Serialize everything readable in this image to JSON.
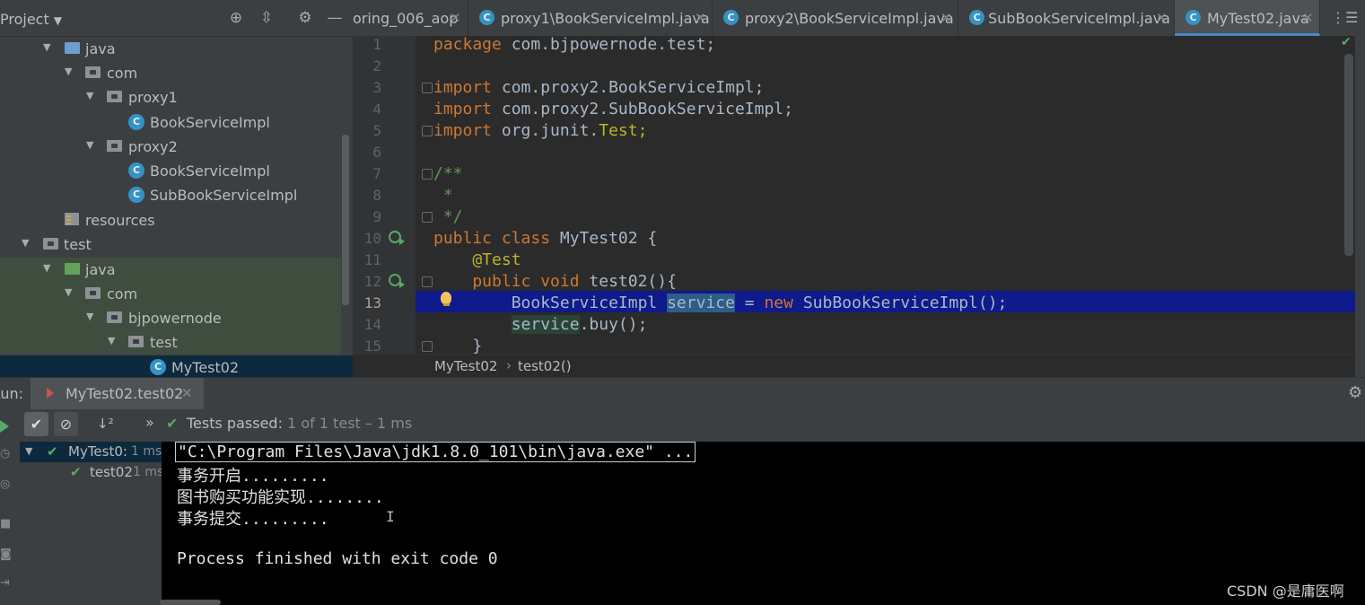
{
  "project": {
    "title": "Project",
    "tree": [
      {
        "label": "java",
        "kind": "folder-blue"
      },
      {
        "label": "com",
        "kind": "package"
      },
      {
        "label": "proxy1",
        "kind": "package"
      },
      {
        "label": "BookServiceImpl",
        "kind": "class"
      },
      {
        "label": "proxy2",
        "kind": "package"
      },
      {
        "label": "BookServiceImpl",
        "kind": "class"
      },
      {
        "label": "SubBookServiceImpl",
        "kind": "class"
      },
      {
        "label": "resources",
        "kind": "resources"
      },
      {
        "label": "test",
        "kind": "folder"
      },
      {
        "label": "java",
        "kind": "folder-green"
      },
      {
        "label": "com",
        "kind": "package"
      },
      {
        "label": "bjpowernode",
        "kind": "package"
      },
      {
        "label": "test",
        "kind": "package"
      },
      {
        "label": "MyTest02",
        "kind": "test-class"
      }
    ]
  },
  "tabs": [
    {
      "label": "oring_006_aop",
      "icon": "module-icon"
    },
    {
      "label": "proxy1\\BookServiceImpl.java",
      "icon": "class-icon"
    },
    {
      "label": "proxy2\\BookServiceImpl.java",
      "icon": "class-icon"
    },
    {
      "label": "SubBookServiceImpl.java",
      "icon": "class-icon"
    },
    {
      "label": "MyTest02.java",
      "icon": "class-icon",
      "active": true
    }
  ],
  "editor": {
    "line_numbers": [
      "1",
      "2",
      "3",
      "4",
      "5",
      "6",
      "7",
      "8",
      "9",
      "10",
      "11",
      "12",
      "13",
      "14",
      "15"
    ],
    "current_line": "13"
  },
  "code": {
    "l1_kw": "package",
    "l1_rest": " com.bjpowernode.test;",
    "l3_kw": "import",
    "l3_rest": " com.proxy2.BookServiceImpl;",
    "l4_kw": "import",
    "l4_rest": " com.proxy2.SubBookServiceImpl;",
    "l5_kw": "import",
    "l5_rest": " org.junit.",
    "l5_ann": "Test;",
    "l7": "/**",
    "l8": " *",
    "l9": " */",
    "l10_kw": "public class",
    "l10_rest": " MyTest02 {",
    "l11": "    @Test",
    "l12_kw": "    public void",
    "l12_rest": " test02(){",
    "l13_type": "        BookServiceImpl ",
    "l13_var": "service",
    "l13_eq": " = ",
    "l13_new": "new",
    "l13_rest": " SubBookServiceImpl();",
    "l14_var": "service",
    "l14_rest": ".buy();",
    "l15": "    }"
  },
  "breadcrumbs": [
    "MyTest02",
    "test02()"
  ],
  "run": {
    "label": "Run:",
    "tab_label": "MyTest02.test02",
    "status_prefix": "Tests passed:",
    "status_detail": "1 of 1 test – 1 ms",
    "tree": [
      {
        "label": "MyTest0:",
        "time": "1 ms"
      },
      {
        "label": "test02",
        "time": "1 ms"
      }
    ]
  },
  "console": {
    "lines": [
      "\"C:\\Program Files\\Java\\jdk1.8.0_101\\bin\\java.exe\" ...",
      "事务开启.........",
      "图书购买功能实现........",
      "事务提交.........",
      "",
      "Process finished with exit code 0"
    ]
  },
  "watermark": "CSDN @是庸医啊",
  "colors": {
    "keyword": "#cc7832",
    "comment": "#629755",
    "annotation": "#bbb529",
    "highlight_line": "#0f1a8c",
    "success": "#59a869"
  }
}
